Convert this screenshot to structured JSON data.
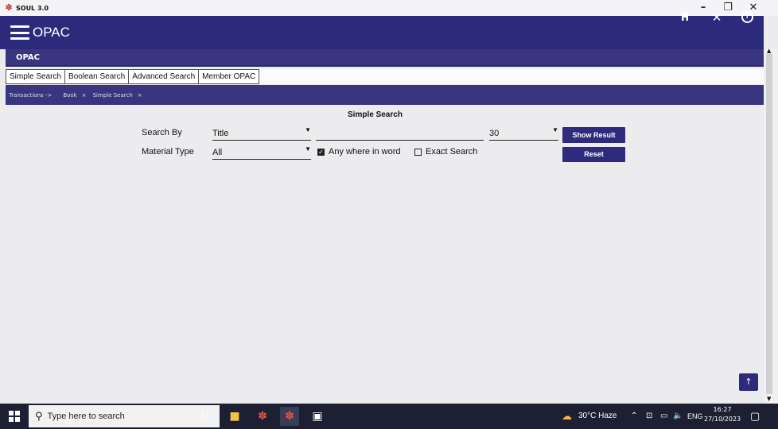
{
  "window": {
    "title": "SOUL 3.0",
    "minimize": "–",
    "maximize": "❐",
    "close": "✕"
  },
  "header": {
    "brand": "OPAC",
    "home_icon": "home-icon",
    "close_icon": "close-icon",
    "help_icon": "help-icon"
  },
  "section": {
    "label": "OPAC"
  },
  "tabs": [
    {
      "label": "Simple Search"
    },
    {
      "label": "Boolean Search"
    },
    {
      "label": "Advanced Search"
    },
    {
      "label": "Member OPAC"
    }
  ],
  "breadcrumbs": [
    {
      "label": "Transactions ->"
    },
    {
      "label": "Book",
      "close": "×"
    },
    {
      "label": "Simple Search",
      "close": "×"
    }
  ],
  "form": {
    "title": "Simple Search",
    "search_by_label": "Search By",
    "search_by_value": "Title",
    "search_text_value": "",
    "result_count": "30",
    "material_type_label": "Material Type",
    "material_type_value": "All",
    "any_where_in_word": {
      "label": "Any where in word",
      "checked": true
    },
    "exact_search": {
      "label": "Exact Search",
      "checked": false
    },
    "show_result_label": "Show Result",
    "reset_label": "Reset"
  },
  "taskbar": {
    "search_placeholder": "Type here to search",
    "weather": "30°C Haze",
    "language": "ENG",
    "time": "16:27",
    "date": "27/10/2023"
  },
  "colors": {
    "header_bg": "#2c2a7a",
    "button_bg": "#2e2b7c",
    "taskbar_bg": "#1d1f33"
  }
}
